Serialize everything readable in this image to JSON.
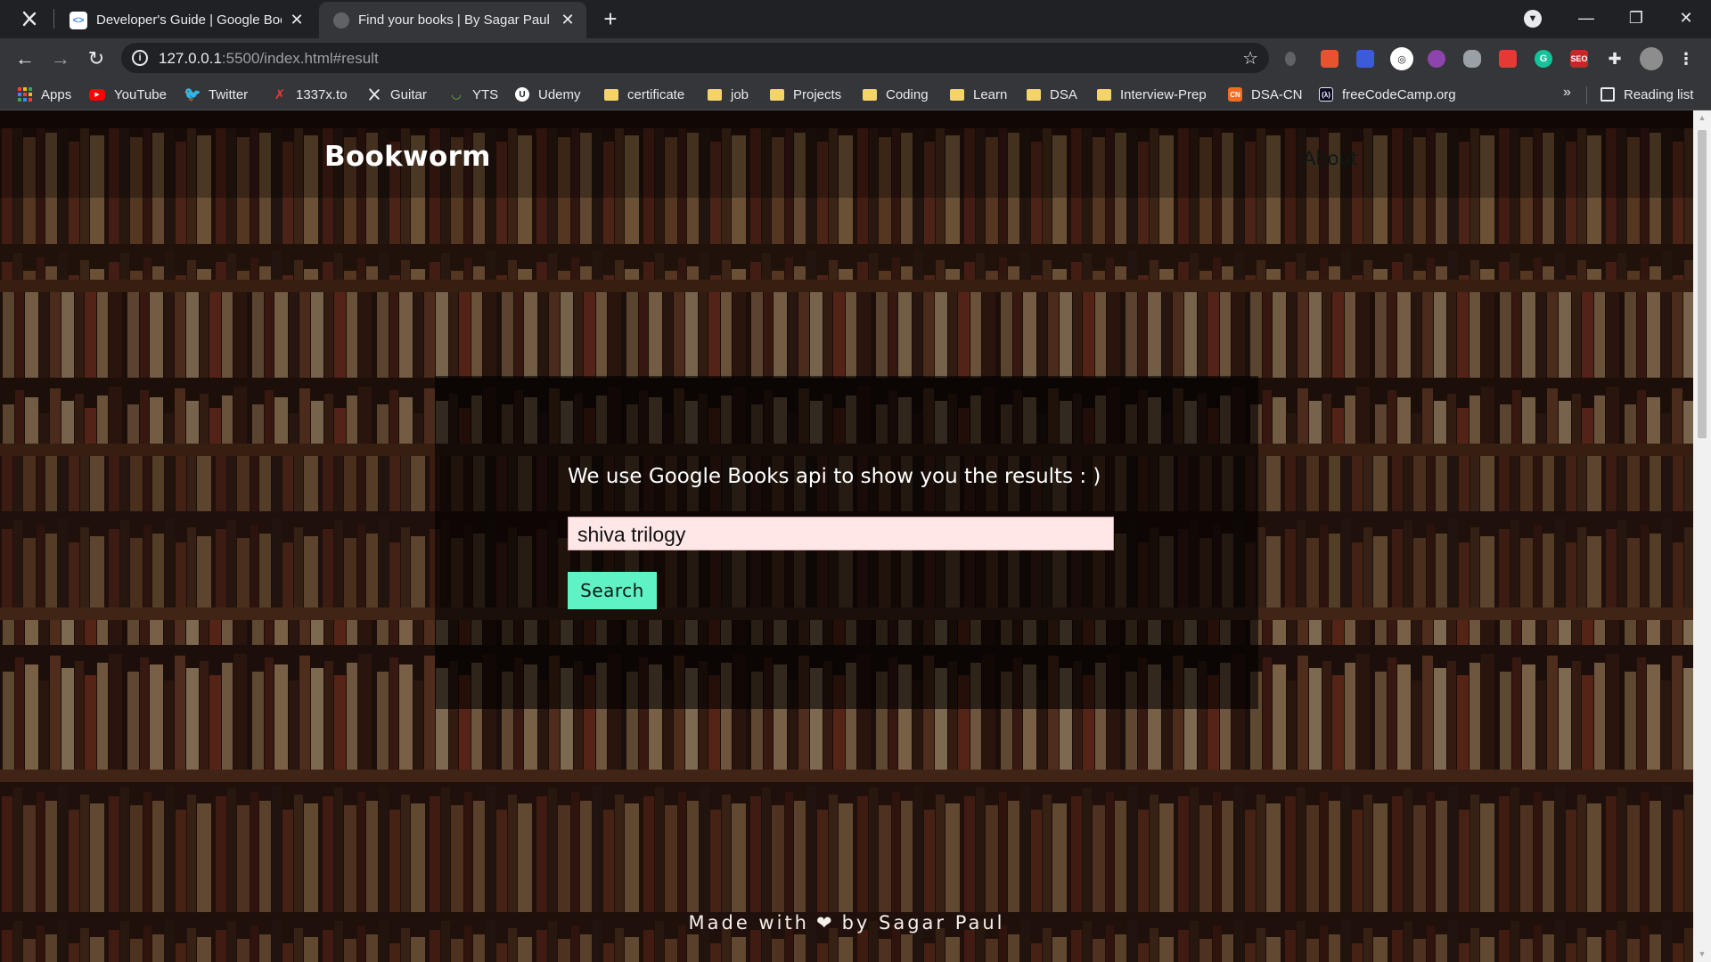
{
  "browser": {
    "tabs": [
      {
        "title": "Developer's Guide  |  Google Boo",
        "favicon": "google-developers-icon",
        "active": false
      },
      {
        "title": "Find your books | By Sagar Paul",
        "favicon": "globe-icon",
        "active": true
      }
    ],
    "address": {
      "host": "127.0.0.1",
      "path": ":5500/index.html#result"
    },
    "bookmarks": [
      {
        "label": "Apps",
        "icon": "apps-grid-icon"
      },
      {
        "label": "YouTube",
        "icon": "youtube-icon"
      },
      {
        "label": "Twitter",
        "icon": "twitter-icon"
      },
      {
        "label": "1337x.to",
        "icon": "1337x-icon"
      },
      {
        "label": "Guitar",
        "icon": "guitar-icon"
      },
      {
        "label": "YTS",
        "icon": "yts-icon"
      },
      {
        "label": "Udemy",
        "icon": "udemy-icon"
      },
      {
        "label": "certificate",
        "icon": "folder-icon"
      },
      {
        "label": "job",
        "icon": "folder-icon"
      },
      {
        "label": "Projects",
        "icon": "folder-icon"
      },
      {
        "label": "Coding",
        "icon": "folder-icon"
      },
      {
        "label": "Learn",
        "icon": "folder-icon"
      },
      {
        "label": "DSA",
        "icon": "folder-icon"
      },
      {
        "label": "Interview-Prep",
        "icon": "folder-icon"
      },
      {
        "label": "DSA-CN",
        "icon": "codingninjas-icon"
      },
      {
        "label": "freeCodeCamp.org",
        "icon": "freecodecamp-icon"
      }
    ],
    "bookmarks_more": "»",
    "reading_list": "Reading list"
  },
  "page": {
    "brand": "Bookworm",
    "nav_about": "About",
    "search_heading": "We use Google Books api to show you the results : )",
    "search_value": "shiva trilogy",
    "search_button": "Search",
    "footer_left": "Made with",
    "footer_right": "by Sagar Paul"
  },
  "colors": {
    "accent": "#5ff2c5",
    "input_bg": "#ffe7e7",
    "chrome_dark": "#202124",
    "chrome_mid": "#35363a"
  }
}
